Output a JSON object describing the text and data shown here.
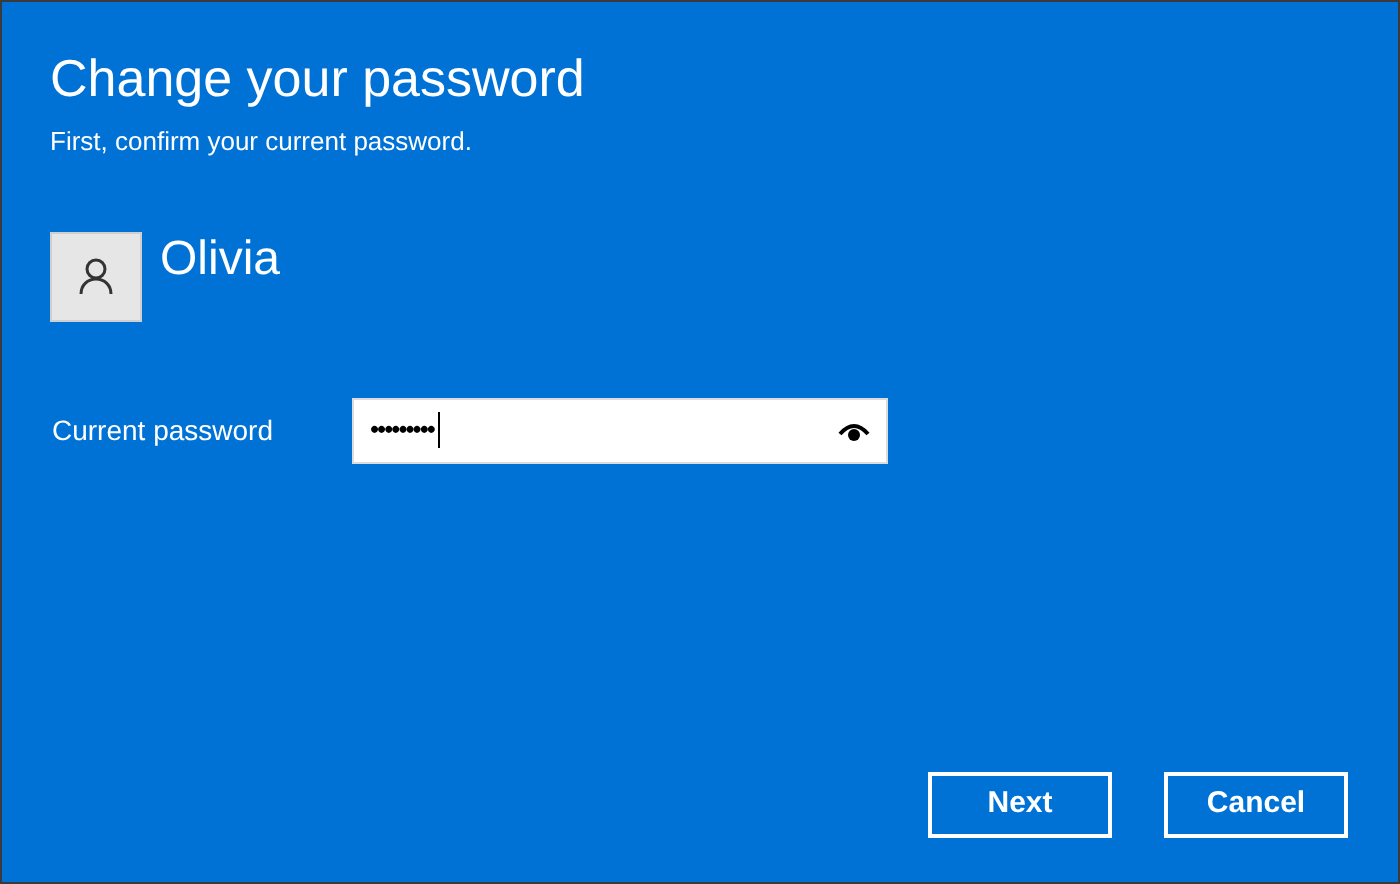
{
  "dialog": {
    "title": "Change your password",
    "subtitle": "First, confirm your current password."
  },
  "user": {
    "name": "Olivia"
  },
  "password_field": {
    "label": "Current password",
    "value": "•••••••••"
  },
  "buttons": [
    {
      "label": "Next"
    },
    {
      "label": "Cancel"
    }
  ]
}
